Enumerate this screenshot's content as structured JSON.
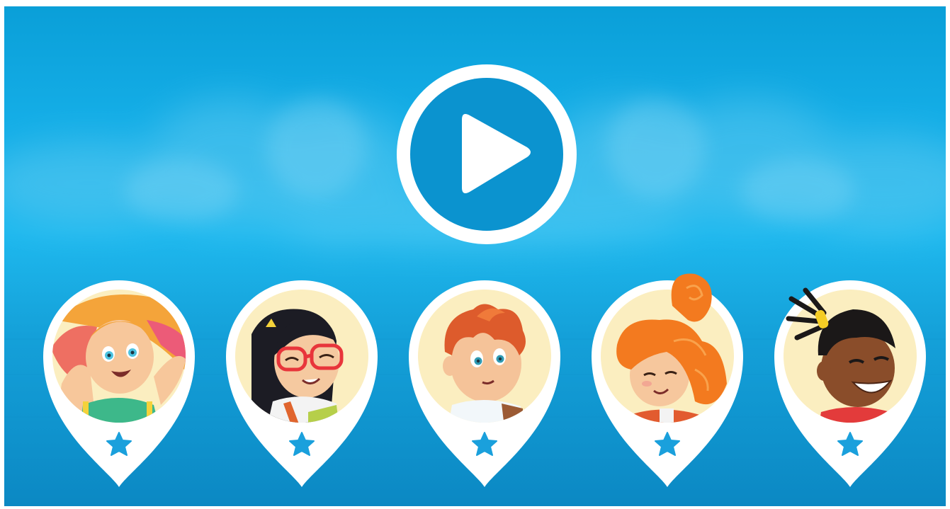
{
  "screen": "character-select",
  "play_button": {
    "icon": "play-icon",
    "ring_color": "#ffffff",
    "fill_color": "#0b93cf",
    "triangle_color": "#ffffff"
  },
  "characters": [
    {
      "id": "girl-blonde",
      "hair": "#f4a43a",
      "hair_tip": "#ec5b78",
      "skin": "#f7c79b",
      "eyes": "#4cc3e0",
      "shirt": "#3db88a",
      "accessory": "none",
      "star_icon": "star-icon"
    },
    {
      "id": "girl-glasses",
      "hair": "#1c1c24",
      "skin": "#f5c9a0",
      "glasses": "#e8353b",
      "shirt": "#f3f3f3",
      "strap": "#e0652e",
      "accessory": "hair-clip",
      "star_icon": "star-icon"
    },
    {
      "id": "boy-redhead",
      "hair": "#dd5b2c",
      "skin": "#f5c399",
      "eyes": "#2f9ab3",
      "shirt": "#f2f7fa",
      "strap": "#9b5a34",
      "accessory": "none",
      "star_icon": "star-icon"
    },
    {
      "id": "girl-curly-orange",
      "hair": "#f37a1f",
      "skin": "#f6c79d",
      "shirt": "#e25b2f",
      "accessory": "none",
      "star_icon": "star-icon"
    },
    {
      "id": "boy-dark",
      "hair": "#1b1818",
      "skin": "#8a4d2a",
      "band": "#f4cc25",
      "shirt": "#e33b3b",
      "accessory": "dreadlocks",
      "star_icon": "star-icon"
    }
  ],
  "colors": {
    "pin_white": "#ffffff",
    "avatar_bg": "#fbeec0",
    "star": "#1aa0dc"
  }
}
